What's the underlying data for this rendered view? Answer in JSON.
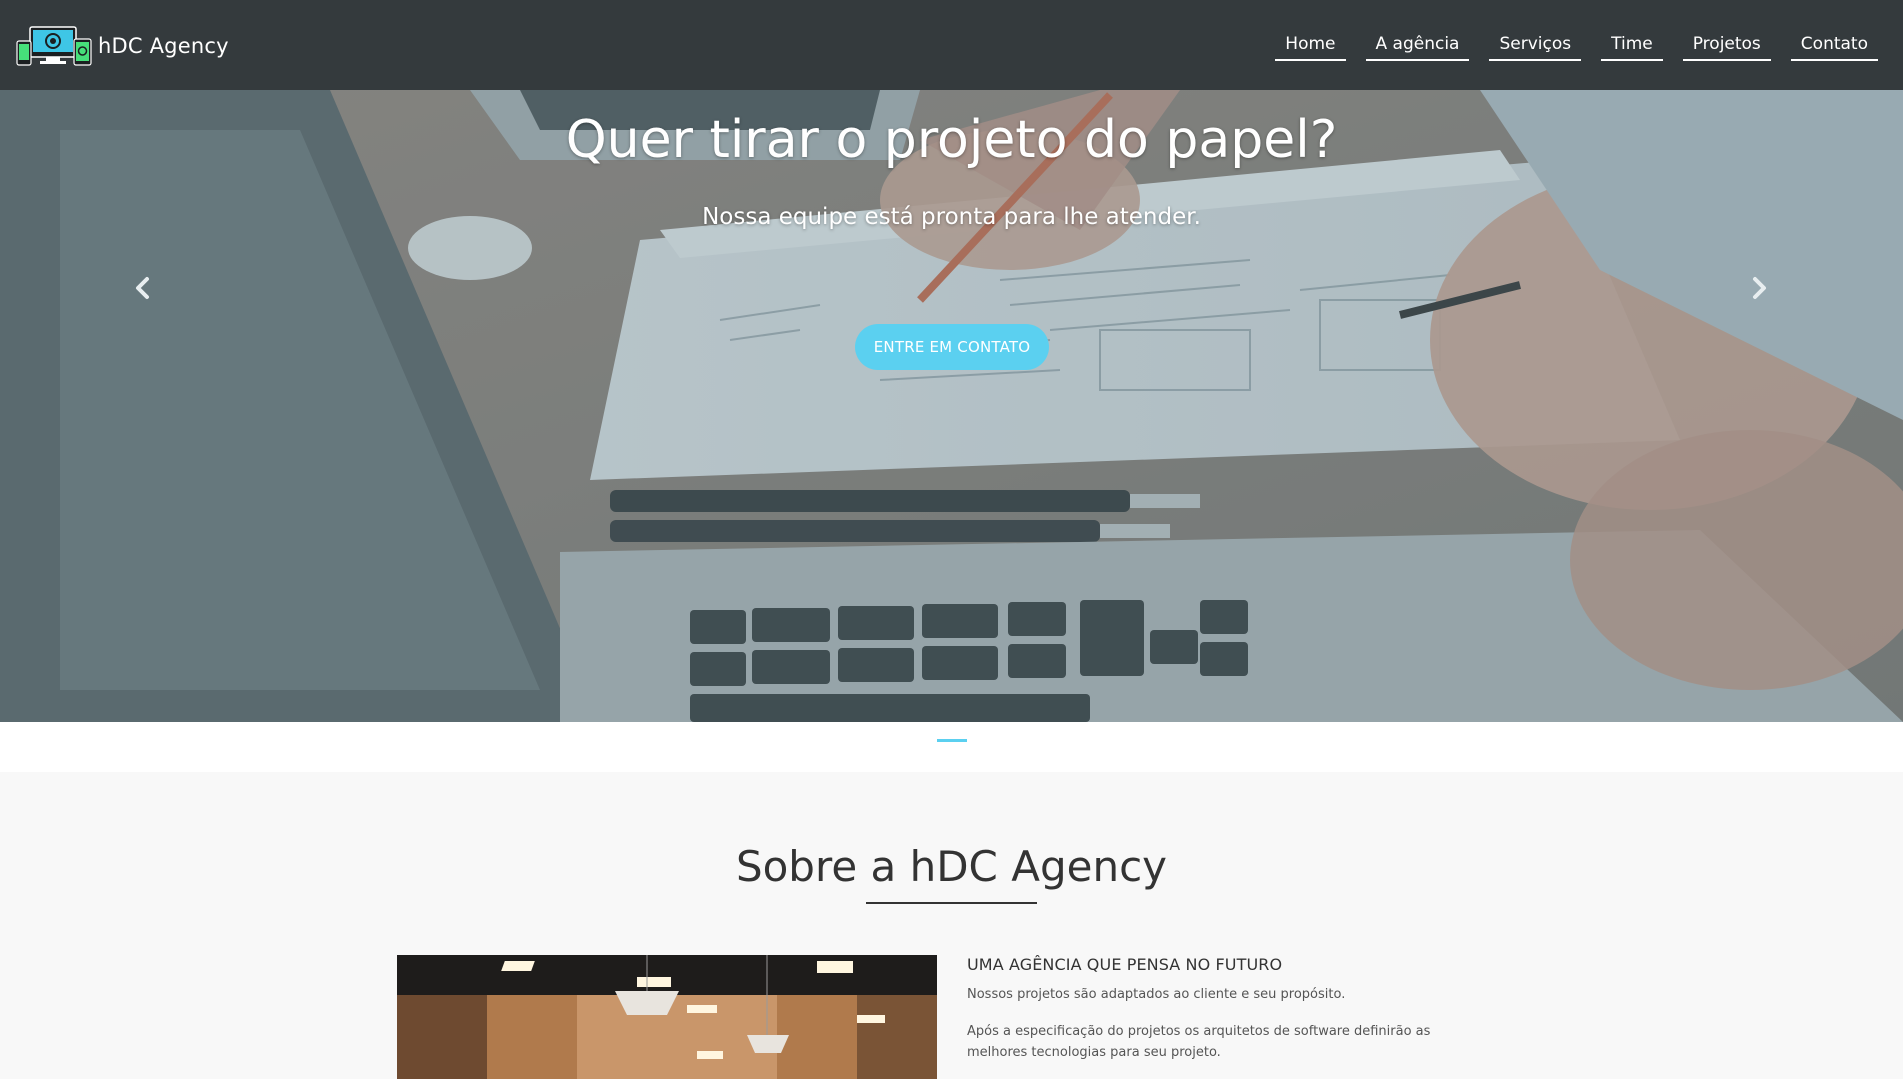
{
  "brand": {
    "name": "hDC Agency",
    "logo_icon": "devices-logo-icon"
  },
  "nav": {
    "items": [
      {
        "label": "Home"
      },
      {
        "label": "A agência"
      },
      {
        "label": "Serviços"
      },
      {
        "label": "Time"
      },
      {
        "label": "Projetos"
      },
      {
        "label": "Contato"
      }
    ]
  },
  "hero": {
    "title": "Quer tirar o projeto do papel?",
    "subtitle": "Nossa equipe está pronta para lhe atender.",
    "cta_label": "ENTRE EM CONTATO",
    "prev_icon": "chevron-left-icon",
    "next_icon": "chevron-right-icon"
  },
  "about": {
    "title": "Sobre a hDC Agency",
    "heading": "UMA AGÊNCIA QUE PENSA NO FUTURO",
    "paragraph1": "Nossos projetos são adaptados ao cliente e seu propósito.",
    "paragraph2": "Após a especificação do projetos os arquitetos de software definirão as melhores tecnologias para seu projeto."
  },
  "colors": {
    "navbar_bg": "#343a3d",
    "accent": "#5bd0f0",
    "page_bg": "#f8f8f8",
    "text_dark": "#333333"
  }
}
